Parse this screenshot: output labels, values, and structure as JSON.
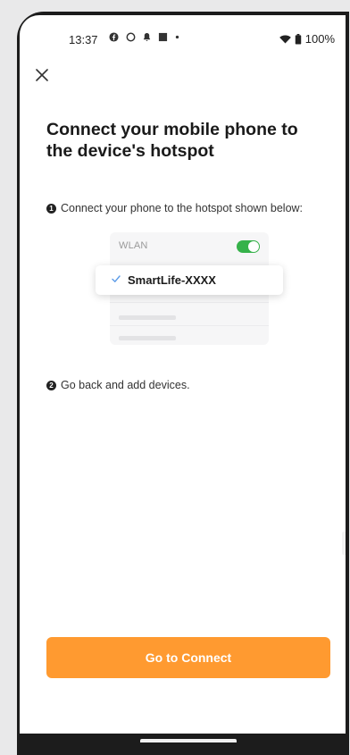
{
  "status_bar": {
    "time": "13:37",
    "battery": "100%",
    "icons": [
      "facebook-icon",
      "circle-icon",
      "notification-icon",
      "square-icon",
      "dot-icon",
      "wifi-icon",
      "battery-icon"
    ]
  },
  "header": {
    "close_icon": "close-icon"
  },
  "page": {
    "title": "Connect your mobile phone to the device's hotspot",
    "step1_num": "1",
    "step1": "Connect your phone to the hotspot shown below:",
    "step2_num": "2",
    "step2": "Go back and add devices."
  },
  "illustration": {
    "wlan_label": "WLAN",
    "toggle_on": true,
    "network_name": "SmartLife-XXXX",
    "check_icon": "check-icon"
  },
  "actions": {
    "connect_label": "Go to Connect"
  },
  "colors": {
    "accent": "#ff9a30",
    "toggle": "#36b24a",
    "check": "#5b9be8"
  }
}
